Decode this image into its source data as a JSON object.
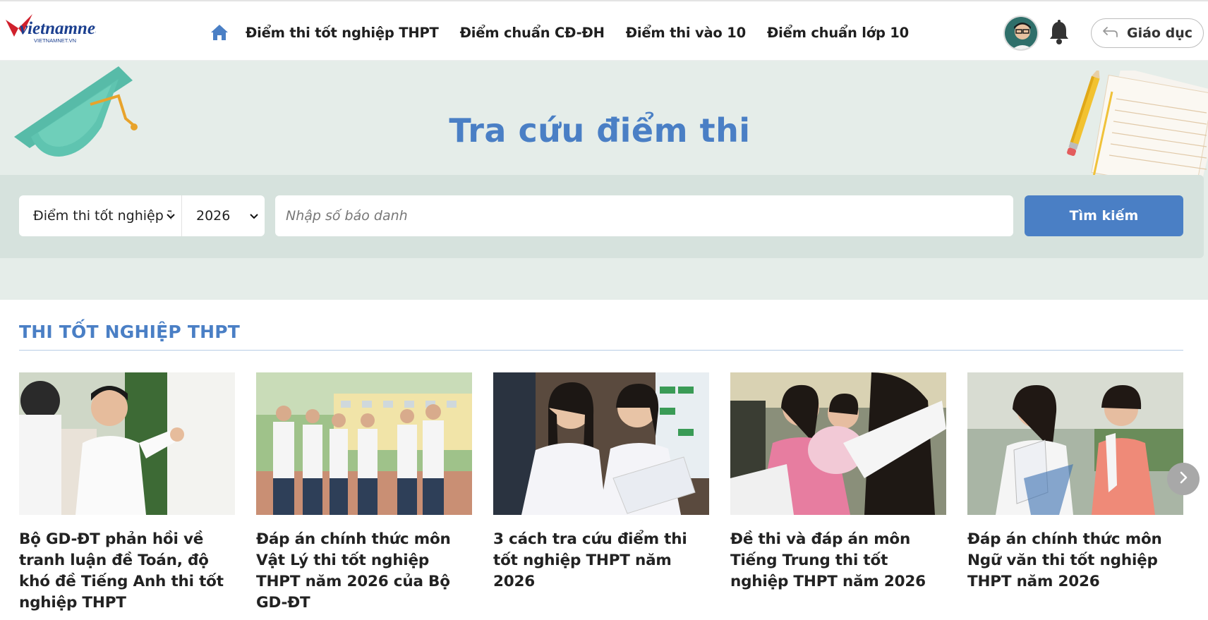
{
  "header": {
    "logo_text": "vietnamnet",
    "logo_subtext": "VIETNAMNET.VN",
    "nav_items": [
      {
        "label": "Điểm thi tốt nghiệp THPT"
      },
      {
        "label": "Điểm chuẩn CĐ-ĐH"
      },
      {
        "label": "Điểm thi vào 10"
      },
      {
        "label": "Điểm chuẩn lớp 10"
      }
    ],
    "section_button_label": "Giáo dục"
  },
  "hero": {
    "title": "Tra cứu điểm thi"
  },
  "search": {
    "exam_select_value": "Điểm thi tốt nghiệp THPT",
    "year_select_value": "2026",
    "input_placeholder": "Nhập số báo danh",
    "button_label": "Tìm kiếm"
  },
  "section": {
    "title": "THI TỐT NGHIỆP THPT",
    "articles": [
      {
        "title": "Bộ GD-ĐT phản hồi về tranh luận đề Toán, độ khó đề Tiếng Anh thi tốt nghiệp THPT"
      },
      {
        "title": "Đáp án chính thức môn Vật Lý thi tốt nghiệp THPT năm 2026 của Bộ GD-ĐT"
      },
      {
        "title": "3 cách tra cứu điểm thi tốt nghiệp THPT năm 2026"
      },
      {
        "title": "Đề thi và đáp án môn Tiếng Trung thi tốt nghiệp THPT năm 2026"
      },
      {
        "title": "Đáp án chính thức môn Ngữ văn thi tốt nghiệp THPT năm 2026"
      }
    ]
  },
  "colors": {
    "brand_red": "#d0202c",
    "accent_blue": "#4a7fc5",
    "hero_bg": "#e5ede9",
    "search_bar_bg": "#d6e2dd"
  },
  "icons": {
    "home": "home-icon",
    "bell": "bell-icon",
    "back": "back-arrow-icon",
    "chevron": "chevron-down-icon",
    "next": "chevron-right-icon"
  }
}
